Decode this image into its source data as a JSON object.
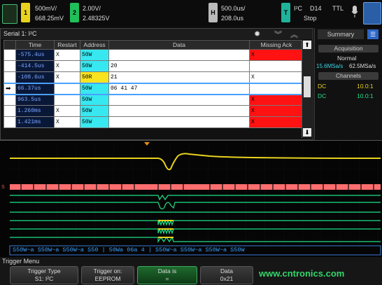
{
  "topbar": {
    "ch1_num": "1",
    "ch1_scale": "500mV/",
    "ch1_offset": "668.25mV",
    "ch2_num": "2",
    "ch2_scale": "2.00V/",
    "ch2_offset": "2.48325V",
    "h_label": "H",
    "time_scale": "500.0us/",
    "time_pos": "208.0us",
    "t_label": "T",
    "trig_proto": "I²C",
    "trig_src": "D14",
    "trig_level": "TTL",
    "run_state": "Stop"
  },
  "serial": {
    "title": "Serial 1: I²C",
    "columns": [
      "Time",
      "Restart",
      "Address",
      "Data",
      "Missing Ack"
    ],
    "rows": [
      {
        "time": "-575.4us",
        "restart": "X",
        "address": "50W",
        "data": "",
        "ack": "X",
        "ack_red": true,
        "addr_yellow": false
      },
      {
        "time": "-414.5us",
        "restart": "X",
        "address": "50W",
        "data": "20",
        "ack": "",
        "ack_red": false,
        "addr_yellow": false
      },
      {
        "time": "-108.6us",
        "restart": "X",
        "address": "50R",
        "data": "21",
        "ack": "X",
        "ack_red": false,
        "addr_yellow": true
      },
      {
        "time": "66.37us",
        "restart": "",
        "address": "50W",
        "data": "06 41 47",
        "ack": "",
        "ack_red": false,
        "addr_yellow": false,
        "selected": true
      },
      {
        "time": "963.5us",
        "restart": "",
        "address": "50W",
        "data": "",
        "ack": "X",
        "ack_red": true,
        "addr_yellow": false
      },
      {
        "time": "1.260ms",
        "restart": "X",
        "address": "50W",
        "data": "",
        "ack": "X",
        "ack_red": true,
        "addr_yellow": false
      },
      {
        "time": "1.421ms",
        "restart": "X",
        "address": "50W",
        "data": "",
        "ack": "X",
        "ack_red": true,
        "addr_yellow": false
      }
    ]
  },
  "summary": {
    "tab_label": "Summary",
    "acq_header": "Acquisition",
    "acq_mode": "Normal",
    "sample_rate_a": "15.6MSa/s",
    "sample_rate_b": "62.5MSa/s",
    "channels_header": "Channels",
    "channels": [
      {
        "coupling": "DC",
        "probe": "10.0:1"
      },
      {
        "coupling": "DC",
        "probe": "10.0:1"
      }
    ]
  },
  "waveform": {
    "decode_strip": "S50W~a  S50W~a  S50W~a  S50  |  50Wa  06a  4  |  S50W~a  S50W~a  S50W~a  S50W",
    "colors": {
      "analog": "#e8d21e",
      "digital": "#1fe08a",
      "serial_bg": "#ff6e6e"
    }
  },
  "menu": {
    "title": "Trigger Menu",
    "keys": [
      {
        "label": "Trigger Type",
        "value": "S1: I²C"
      },
      {
        "label": "Trigger on:",
        "value": "EEPROM"
      },
      {
        "label": "Data is",
        "value": "="
      },
      {
        "label": "Data",
        "value": "0x21"
      }
    ],
    "watermark": "www.cntronics.com"
  }
}
